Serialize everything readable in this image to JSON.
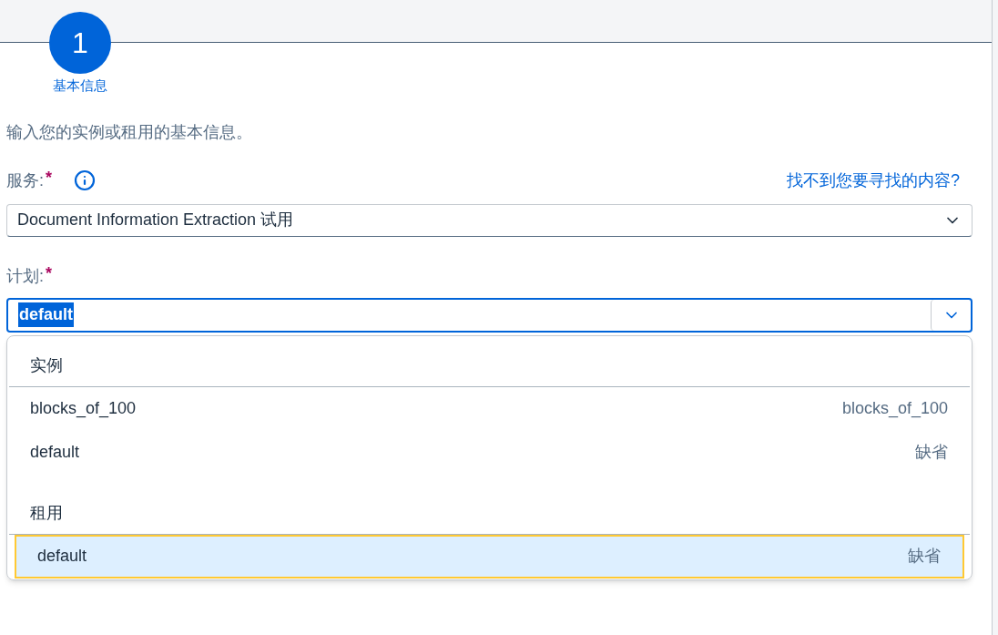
{
  "step": {
    "number": "1",
    "label": "基本信息",
    "selected": true
  },
  "description": "输入您的实例或租用的基本信息。",
  "service": {
    "label": "服务:",
    "required_mark": "*",
    "value": "Document Information Extraction 试用"
  },
  "help_link": "找不到您要寻找的内容?",
  "plan": {
    "label": "计划:",
    "required_mark": "*",
    "value": "default",
    "text_selected": true,
    "expanded": true
  },
  "groups": [
    {
      "title": "实例",
      "items": [
        {
          "label": "blocks_of_100",
          "detail": "blocks_of_100",
          "selected": false
        },
        {
          "label": "default",
          "detail": "缺省",
          "selected": false
        }
      ]
    },
    {
      "title": "租用",
      "items": [
        {
          "label": "default",
          "detail": "缺省",
          "selected": true
        }
      ]
    }
  ]
}
